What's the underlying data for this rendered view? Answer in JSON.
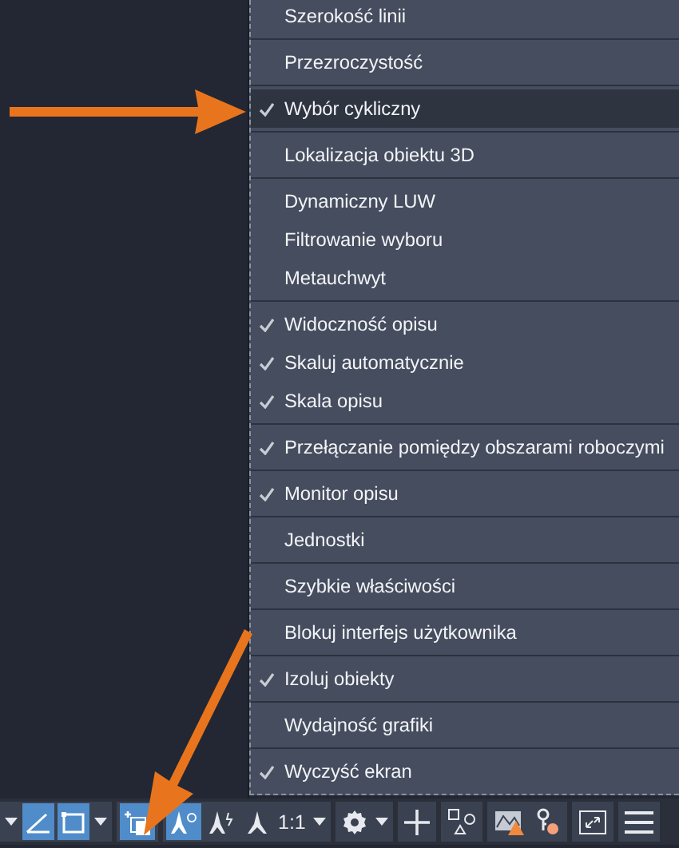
{
  "menu": {
    "groups": [
      {
        "items": [
          {
            "label": "Szerokość linii",
            "checked": false,
            "selected": false
          }
        ]
      },
      {
        "items": [
          {
            "label": "Przezroczystość",
            "checked": false,
            "selected": false
          }
        ]
      },
      {
        "items": [
          {
            "label": "Wybór cykliczny",
            "checked": true,
            "selected": true
          }
        ]
      },
      {
        "items": [
          {
            "label": "Lokalizacja obiektu 3D",
            "checked": false,
            "selected": false
          }
        ]
      },
      {
        "items": [
          {
            "label": "Dynamiczny LUW",
            "checked": false,
            "selected": false
          },
          {
            "label": "Filtrowanie wyboru",
            "checked": false,
            "selected": false
          },
          {
            "label": "Metauchwyt",
            "checked": false,
            "selected": false
          }
        ]
      },
      {
        "items": [
          {
            "label": "Widoczność opisu",
            "checked": true,
            "selected": false
          },
          {
            "label": "Skaluj automatycznie",
            "checked": true,
            "selected": false
          },
          {
            "label": "Skala opisu",
            "checked": true,
            "selected": false
          }
        ]
      },
      {
        "items": [
          {
            "label": "Przełączanie pomiędzy obszarami roboczymi",
            "checked": true,
            "selected": false
          }
        ]
      },
      {
        "items": [
          {
            "label": "Monitor opisu",
            "checked": true,
            "selected": false
          }
        ]
      },
      {
        "items": [
          {
            "label": "Jednostki",
            "checked": false,
            "selected": false
          }
        ]
      },
      {
        "items": [
          {
            "label": "Szybkie właściwości",
            "checked": false,
            "selected": false
          }
        ]
      },
      {
        "items": [
          {
            "label": "Blokuj interfejs użytkownika",
            "checked": false,
            "selected": false
          }
        ]
      },
      {
        "items": [
          {
            "label": "Izoluj obiekty",
            "checked": true,
            "selected": false
          }
        ]
      },
      {
        "items": [
          {
            "label": "Wydajność grafiki",
            "checked": false,
            "selected": false
          }
        ]
      },
      {
        "items": [
          {
            "label": "Wyczyść ekran",
            "checked": true,
            "selected": false
          }
        ]
      }
    ]
  },
  "status_bar": {
    "groups": [
      {
        "buttons": [
          {
            "kind": "caret",
            "on": false
          },
          {
            "kind": "angle",
            "on": true
          },
          {
            "kind": "frame",
            "on": true
          },
          {
            "kind": "caret",
            "on": false
          }
        ]
      },
      {
        "buttons": [
          {
            "kind": "tiles",
            "on": true
          }
        ]
      },
      {
        "buttons": [
          {
            "kind": "figure-dot",
            "on": true
          },
          {
            "kind": "figure-spark",
            "on": false
          },
          {
            "kind": "figure",
            "on": false
          },
          {
            "kind": "scale",
            "label": "1:1",
            "on": false
          },
          {
            "kind": "caret",
            "on": false
          }
        ]
      },
      {
        "buttons": [
          {
            "kind": "gear",
            "on": false
          },
          {
            "kind": "caret",
            "on": false
          }
        ]
      },
      {
        "buttons": [
          {
            "kind": "plus",
            "on": false
          }
        ]
      },
      {
        "buttons": [
          {
            "kind": "shapes",
            "on": false
          }
        ]
      },
      {
        "buttons": [
          {
            "kind": "graph-warning",
            "on": false
          },
          {
            "kind": "key",
            "on": false
          }
        ]
      },
      {
        "buttons": [
          {
            "kind": "fullscreen",
            "on": false
          }
        ]
      },
      {
        "buttons": [
          {
            "kind": "menu",
            "on": false
          }
        ]
      }
    ]
  },
  "annotations": [
    {
      "kind": "arrow-right"
    },
    {
      "kind": "arrow-down-left"
    }
  ]
}
